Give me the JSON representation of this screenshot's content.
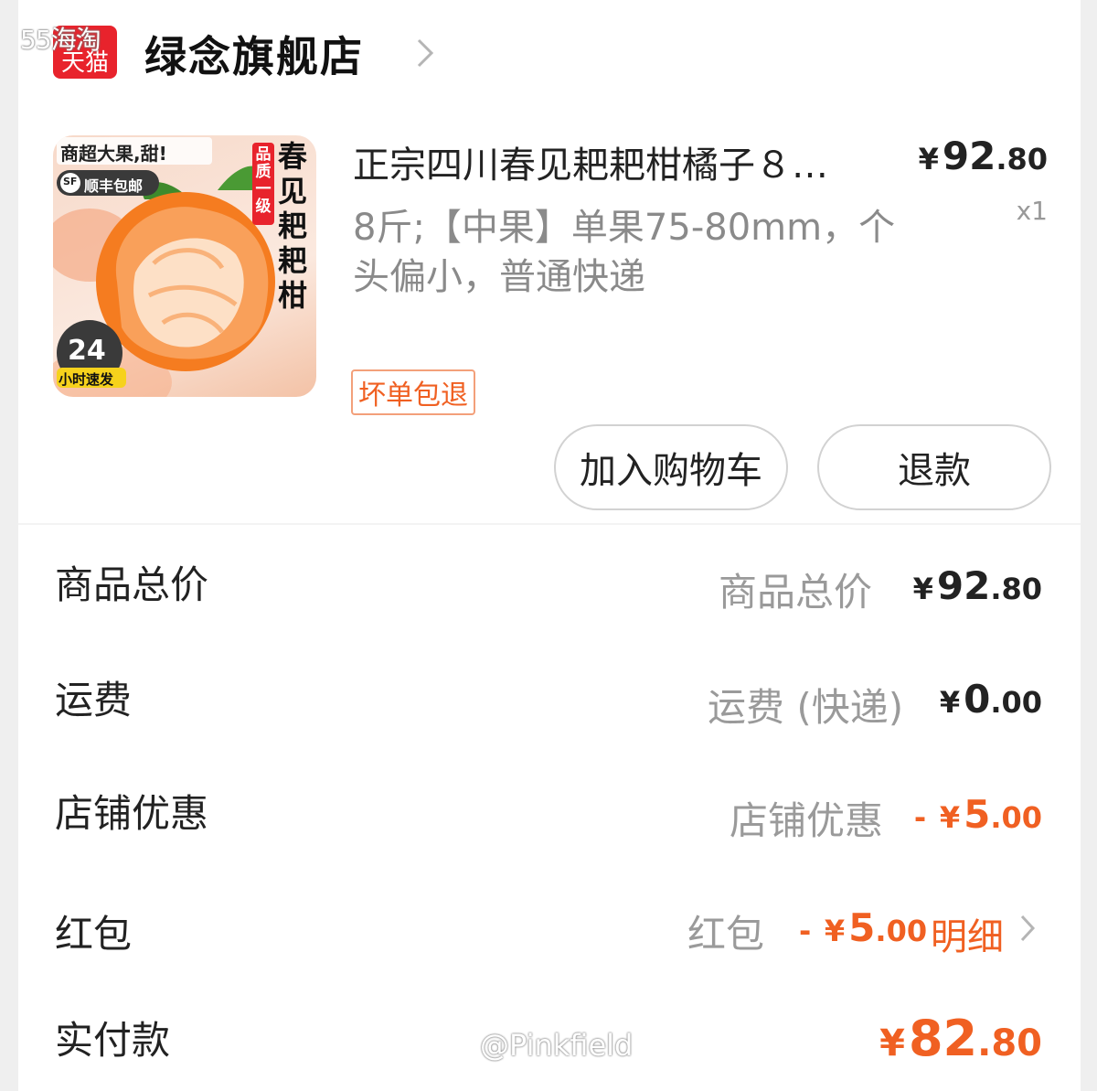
{
  "watermark_corner": "55海淘",
  "shop": {
    "badge": "天猫",
    "name": "绿念旗舰店"
  },
  "product": {
    "image_texts": {
      "top": "商超大果,甜!",
      "shipping": "顺丰包邮",
      "sf": "SF",
      "quality": "品质一级",
      "name": "春见耙耙柑",
      "hours": "24",
      "fast": "小时速发"
    },
    "title": "正宗四川春见耙耙柑橘子８…",
    "price": {
      "yen": "¥",
      "int": "92",
      "dec": ".80"
    },
    "qty": "x1",
    "spec": "8斤;【中果】单果75-80mm，个头偏小，普通快递",
    "tag": "坏单包退",
    "actions": {
      "cart": "加入购物车",
      "refund": "退款"
    }
  },
  "summary": {
    "total": {
      "label": "商品总价",
      "sub": "商品总价",
      "yen": "¥",
      "int": "92",
      "dec": ".80"
    },
    "shipping": {
      "label": "运费",
      "sub": "运费 (快递)",
      "yen": "¥",
      "int": "0",
      "dec": ".00"
    },
    "shop_discount": {
      "label": "店铺优惠",
      "sub": "店铺优惠",
      "sign": "-",
      "yen": "¥",
      "int": "5",
      "dec": ".00"
    },
    "red_packet": {
      "label": "红包",
      "sub": "红包",
      "sign": "-",
      "yen": "¥",
      "int": "5",
      "dec": ".00",
      "detail": "明细"
    },
    "paid": {
      "label": "实付款",
      "yen": "¥",
      "int": "82",
      "dec": ".80"
    }
  },
  "watermark_footer": "@Pinkfield",
  "colors": {
    "accent": "#f06022",
    "tmall_red": "#e8232c",
    "orange": "#f57c20"
  }
}
